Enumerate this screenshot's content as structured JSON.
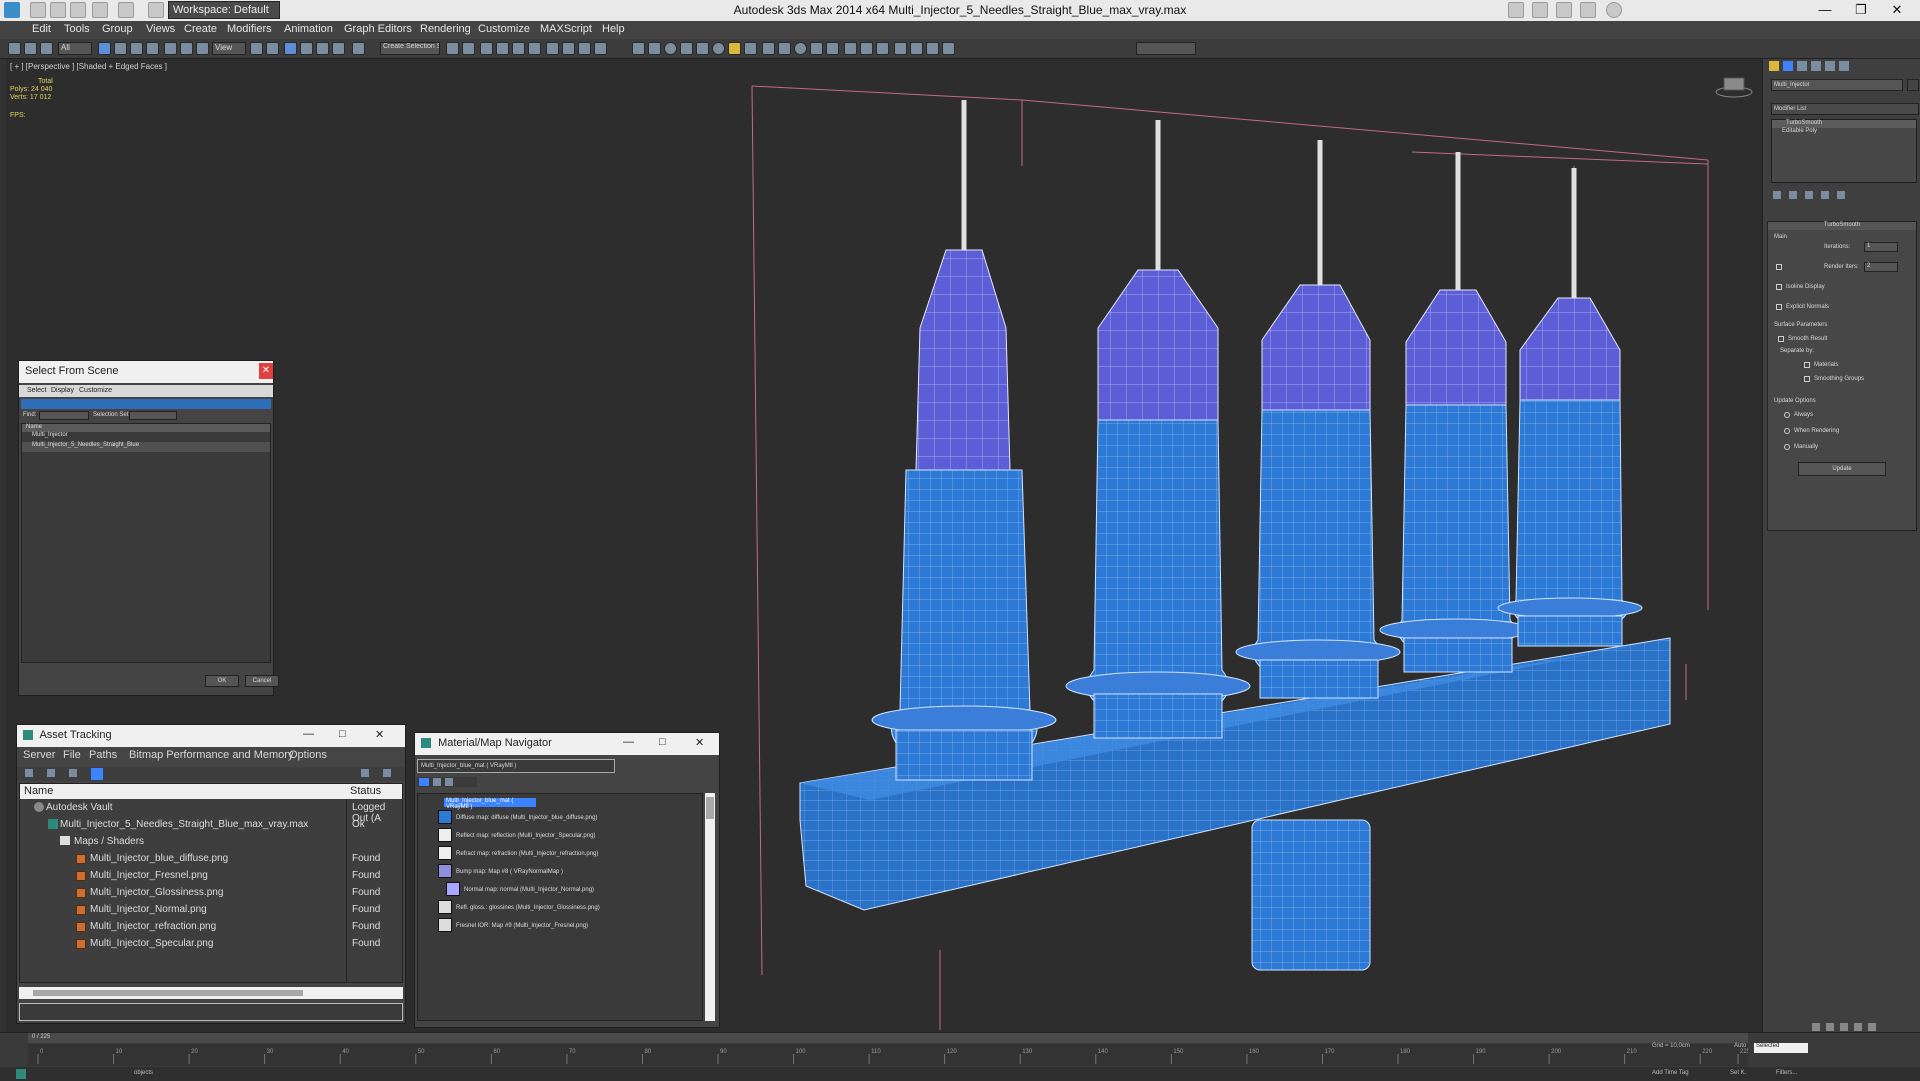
{
  "app": {
    "title": "Autodesk 3ds Max  2014 x64     Multi_Injector_5_Needles_Straight_Blue_max_vray.max",
    "workspace": "Workspace: Default"
  },
  "menu": [
    "Edit",
    "Tools",
    "Group",
    "Views",
    "Create",
    "Modifiers",
    "Animation",
    "Graph Editors",
    "Rendering",
    "Customize",
    "MAXScript",
    "Help"
  ],
  "toolbar": {
    "selection_filter": "All",
    "view_label": "View",
    "named_selection": "Create Selection Se"
  },
  "viewport": {
    "label": "[ + ] [Perspective ] [Shaded + Edged Faces ]",
    "stats": {
      "total": "Total",
      "polys_label": "Polys:",
      "polys": "24 040",
      "verts_label": "Verts:",
      "verts": "17 012"
    },
    "fps_label": "FPS:"
  },
  "select_from_scene": {
    "title": "Select From Scene",
    "menu": [
      "Select",
      "Display",
      "Customize"
    ],
    "find_label": "Find:",
    "selection_set_label": "Selection Set:",
    "column_name": "Name",
    "items": [
      "Multi_Injector",
      "Multi_Injector_5_Needles_Straight_Blue"
    ],
    "ok": "OK",
    "cancel": "Cancel"
  },
  "asset_tracking": {
    "title": "Asset Tracking",
    "menu": [
      "Server",
      "File",
      "Paths",
      "Bitmap Performance and Memory",
      "Options"
    ],
    "col_name": "Name",
    "col_status": "Status",
    "rows": [
      {
        "name": "Autodesk Vault",
        "status": "Logged Out (A"
      },
      {
        "name": "Multi_Injector_5_Needles_Straight_Blue_max_vray.max",
        "status": "Ok"
      },
      {
        "name": "Maps / Shaders",
        "status": ""
      },
      {
        "name": "Multi_Injector_blue_diffuse.png",
        "status": "Found"
      },
      {
        "name": "Multi_Injector_Fresnel.png",
        "status": "Found"
      },
      {
        "name": "Multi_Injector_Glossiness.png",
        "status": "Found"
      },
      {
        "name": "Multi_Injector_Normal.png",
        "status": "Found"
      },
      {
        "name": "Multi_Injector_refraction.png",
        "status": "Found"
      },
      {
        "name": "Multi_Injector_Specular.png",
        "status": "Found"
      }
    ]
  },
  "material_navigator": {
    "title": "Material/Map Navigator",
    "field": "Multi_Injector_blue_mat  ( VRayMtl )",
    "root": "Multi_Injector_blue_mat  ( VRayMtl )",
    "items": [
      "Diffuse map: diffuse (Multi_Injector_blue_diffuse.png)",
      "Reflect map: reflection (Multi_Injector_Specular.png)",
      "Refract map: refraction (Multi_Injector_refraction.png)",
      "Bump map: Map #8  ( VRayNormalMap )",
      "Normal map: normal (Multi_Injector_Normal.png)",
      "Refl. gloss.: glossines (Multi_Injector_Glossiness.png)",
      "Fresnel IOR: Map #9 (Multi_Injector_Fresnel.png)"
    ]
  },
  "command_panel": {
    "object_name": "Multi_Injector",
    "modifier_list": "Modifier List",
    "stack": [
      "TurboSmooth",
      "Editable Poly"
    ],
    "rollout_title": "TurboSmooth",
    "main": "Main",
    "iterations_label": "Iterations:",
    "iterations": "1",
    "render_iters_label": "Render Iters:",
    "render_iters": "2",
    "isoline": "Isoline Display",
    "explicit_normals": "Explicit Normals",
    "surface_params": "Surface Parameters",
    "smooth_result": "Smooth Result",
    "separate_by": "Separate by:",
    "materials": "Materials",
    "smoothing_groups": "Smoothing Groups",
    "update_options": "Update Options",
    "always": "Always",
    "when_rendering": "When Rendering",
    "manually": "Manually",
    "update": "Update"
  },
  "timeline": {
    "frame": "0 / 225",
    "ticks": [
      "0",
      "10",
      "20",
      "30",
      "40",
      "50",
      "60",
      "70",
      "80",
      "90",
      "100",
      "110",
      "120",
      "130",
      "140",
      "150",
      "160",
      "170",
      "180",
      "190",
      "200",
      "210",
      "220",
      "225"
    ],
    "status_objects": "objects",
    "grid_label": "Grid = 10,0cm",
    "auto": "Auto",
    "selected": "Selected",
    "set_k": "Set K.",
    "filters": "Filters...",
    "add_time_tag": "Add Time Tag"
  },
  "colors": {
    "accent": "#3b83ff",
    "body_blue": "#2d7ad6",
    "cap_purple": "#5a5fd2"
  }
}
